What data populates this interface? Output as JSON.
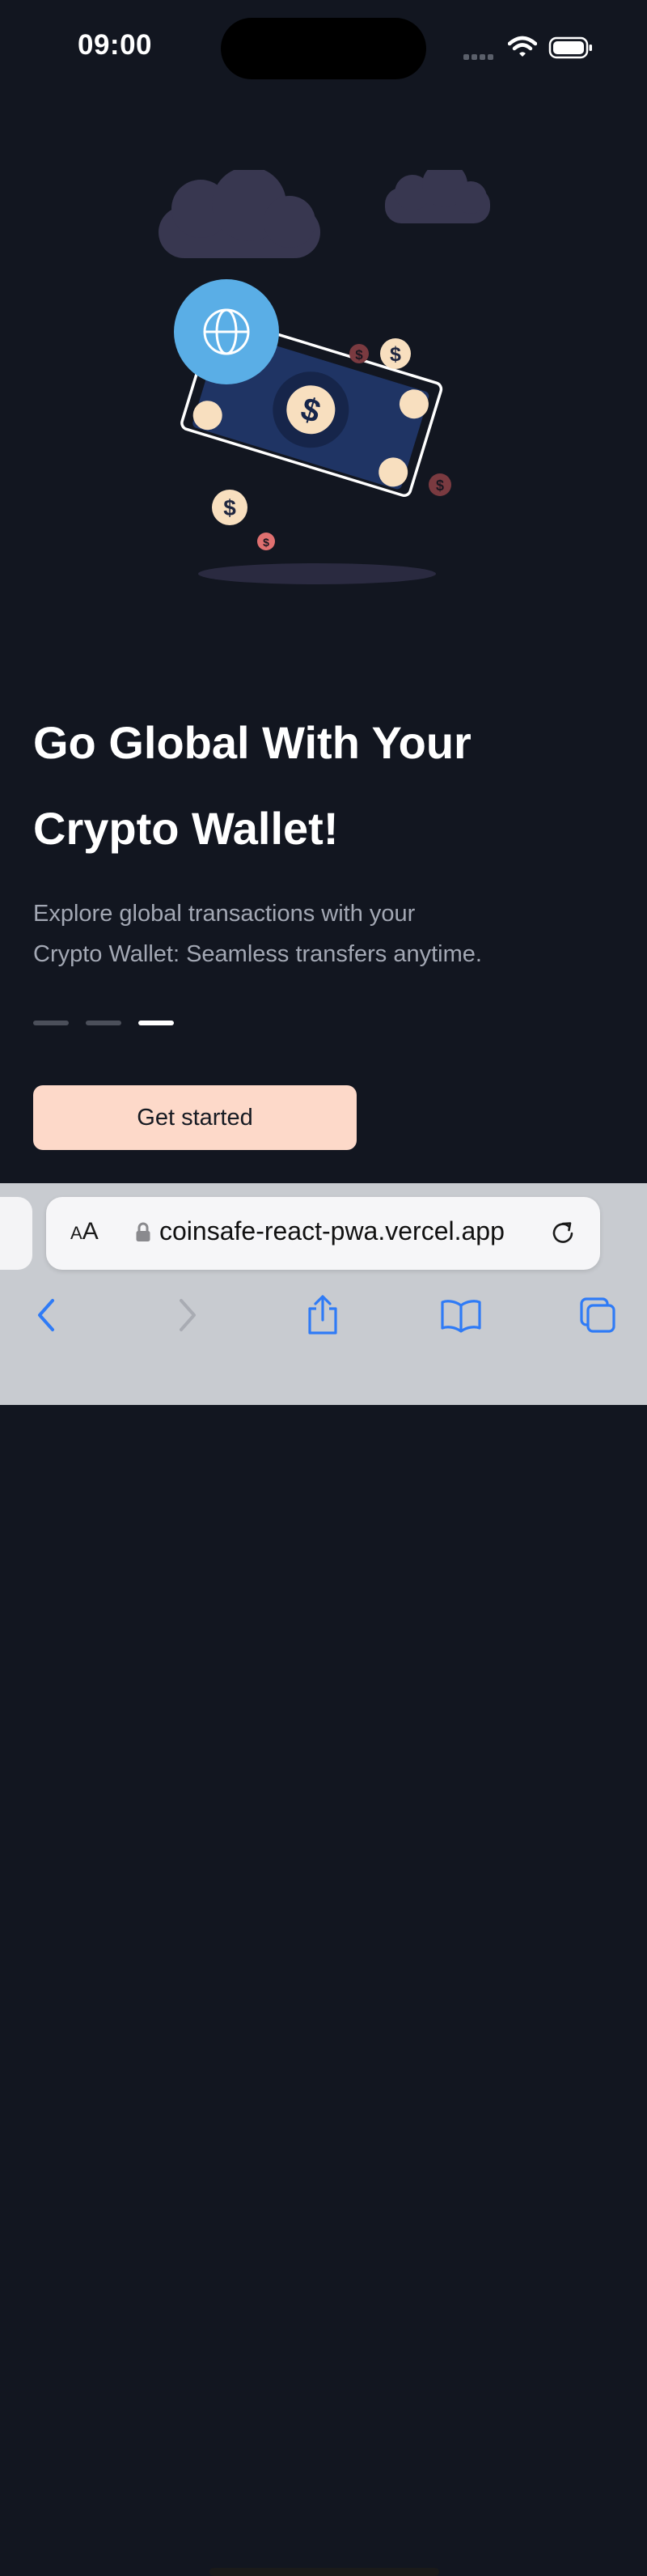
{
  "status_bar": {
    "time": "09:00"
  },
  "onboarding": {
    "headline_line1": "Go Global With Your",
    "headline_line2": "Crypto Wallet!",
    "subtitle_line1": "Explore global transactions with your",
    "subtitle_line2": "Crypto Wallet: Seamless transfers anytime.",
    "pager": {
      "total": 3,
      "active_index": 2
    },
    "cta_label": "Get started"
  },
  "illustration": {
    "currency_symbol": "$",
    "icons": [
      "cloud-icon",
      "globe-icon",
      "banknote-icon",
      "dollar-coin-icon"
    ]
  },
  "browser": {
    "text_size_label": "AA",
    "url": "coinsafe-react-pwa.vercel.app",
    "toolbar": [
      "back-icon",
      "forward-icon",
      "share-icon",
      "bookmarks-icon",
      "tabs-icon"
    ]
  },
  "colors": {
    "background": "#121620",
    "cta_background": "#fdd9c9",
    "globe_accent": "#5aaee6",
    "banknote": "#1f3464",
    "coin": "#f8dfbf",
    "coin_dim": "#7a3a40",
    "browser_accent": "#2f7bf6"
  }
}
